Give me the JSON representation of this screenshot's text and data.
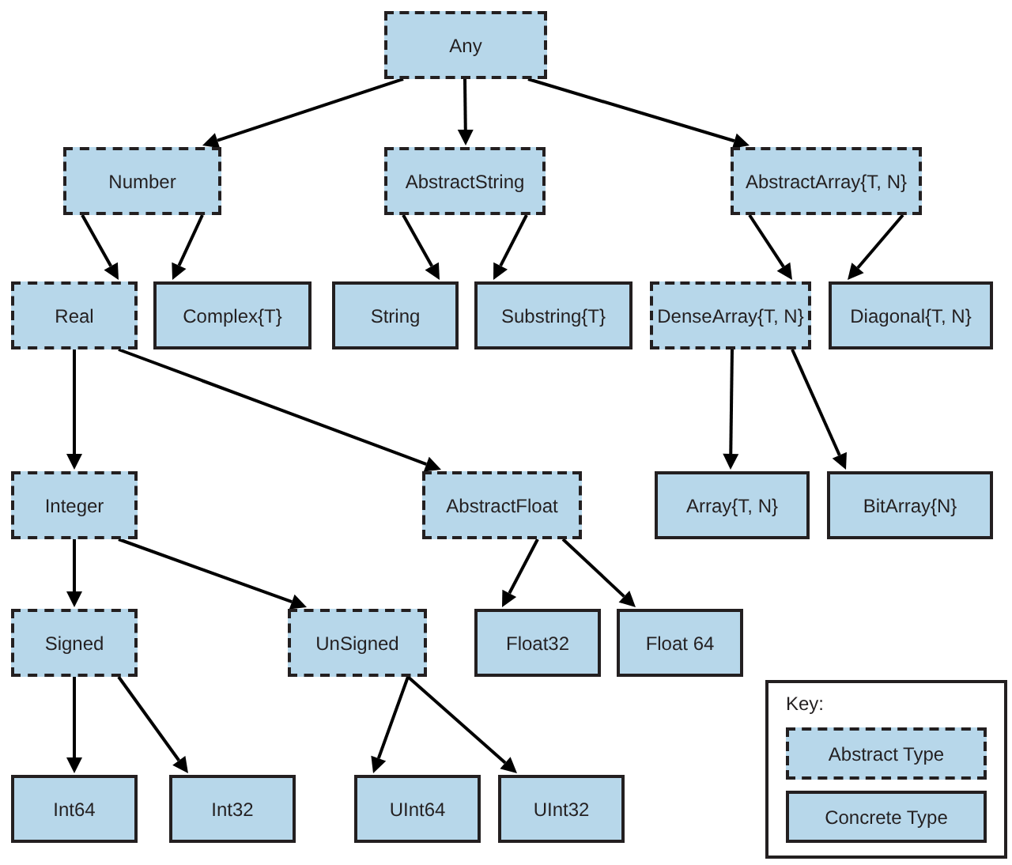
{
  "tree": {
    "label": "Any",
    "kind": "abstract",
    "children": [
      {
        "label": "Number",
        "kind": "abstract",
        "children": [
          {
            "label": "Real",
            "kind": "abstract",
            "children": [
              {
                "label": "Integer",
                "kind": "abstract",
                "children": [
                  {
                    "label": "Signed",
                    "kind": "abstract",
                    "children": [
                      {
                        "label": "Int64",
                        "kind": "concrete"
                      },
                      {
                        "label": "Int32",
                        "kind": "concrete"
                      }
                    ]
                  },
                  {
                    "label": "UnSigned",
                    "kind": "abstract",
                    "children": [
                      {
                        "label": "UInt64",
                        "kind": "concrete"
                      },
                      {
                        "label": "UInt32",
                        "kind": "concrete"
                      }
                    ]
                  }
                ]
              },
              {
                "label": "AbstractFloat",
                "kind": "abstract",
                "children": [
                  {
                    "label": "Float32",
                    "kind": "concrete"
                  },
                  {
                    "label": "Float 64",
                    "kind": "concrete"
                  }
                ]
              }
            ]
          },
          {
            "label": "Complex{T}",
            "kind": "concrete"
          }
        ]
      },
      {
        "label": "AbstractString",
        "kind": "abstract",
        "children": [
          {
            "label": "String",
            "kind": "concrete"
          },
          {
            "label": "Substring{T}",
            "kind": "concrete"
          }
        ]
      },
      {
        "label": "AbstractArray{T, N}",
        "kind": "abstract",
        "children": [
          {
            "label": "DenseArray{T, N}",
            "kind": "abstract",
            "children": [
              {
                "label": "Array{T, N}",
                "kind": "concrete"
              },
              {
                "label": "BitArray{N}",
                "kind": "concrete"
              }
            ]
          },
          {
            "label": "Diagonal{T, N}",
            "kind": "concrete"
          }
        ]
      }
    ]
  },
  "key": {
    "title": "Key:",
    "items": [
      {
        "label": "Abstract Type",
        "kind": "abstract"
      },
      {
        "label": "Concrete Type",
        "kind": "concrete"
      }
    ]
  }
}
